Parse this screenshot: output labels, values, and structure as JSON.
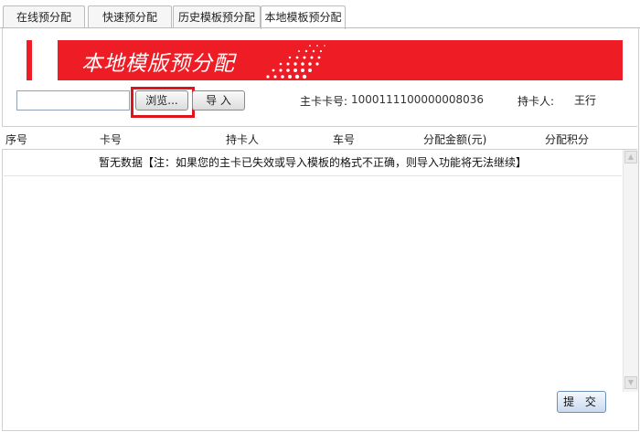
{
  "tabs": [
    {
      "label": "在线预分配",
      "active": false
    },
    {
      "label": "快速预分配",
      "active": false
    },
    {
      "label": "历史模板预分配",
      "active": false
    },
    {
      "label": "本地模板预分配",
      "active": true
    }
  ],
  "banner": {
    "title": "本地模版预分配",
    "color": "#ee1c25"
  },
  "file": {
    "value": "",
    "browse_label": "浏览...",
    "import_label": "导 入"
  },
  "info": {
    "main_card_label": "主卡卡号:",
    "main_card_value": "1000111100000008036",
    "holder_label": "持卡人:",
    "holder_value": "王行"
  },
  "table": {
    "columns": [
      "序号",
      "卡号",
      "持卡人",
      "车号",
      "分配金额(元)",
      "分配积分"
    ],
    "empty_message": "暂无数据【注：如果您的主卡已失效或导入模板的格式不正确，则导入功能将无法继续】"
  },
  "submit_label": "提 交"
}
